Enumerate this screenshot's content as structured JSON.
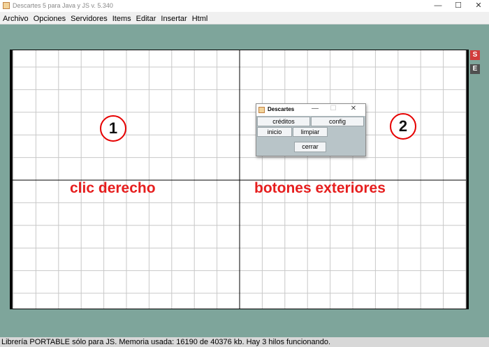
{
  "window": {
    "title": "Descartes 5 para Java y JS v. 5.340",
    "minimize_glyph": "—",
    "maximize_glyph": "☐",
    "close_glyph": "✕"
  },
  "menu": [
    "Archivo",
    "Opciones",
    "Servidores",
    "Items",
    "Editar",
    "Insertar",
    "Html"
  ],
  "side_buttons": {
    "s_label": "S",
    "s_color": "#d23c3c",
    "e_label": "E",
    "e_color": "#505050"
  },
  "annotations": {
    "marker_1": "1",
    "marker_2": "2",
    "left_label": "clic derecho",
    "right_label": "botones exteriores",
    "label_color": "#e61e1e"
  },
  "dialog": {
    "title": "Descartes",
    "minimize_glyph": "—",
    "maximize_glyph": "☐",
    "close_glyph": "✕",
    "buttons": {
      "creditos": "créditos",
      "config": "config",
      "inicio": "inicio",
      "limpiar": "limpiar",
      "cerrar": "cerrar"
    }
  },
  "status": {
    "text": "Librería PORTABLE sólo para JS. Memoria usada: 16190 de 40376 kb. Hay 3 hilos funcionando."
  },
  "colors": {
    "background": "#7ea59b",
    "grid_line": "#c8c8c8",
    "axis": "#000000"
  }
}
